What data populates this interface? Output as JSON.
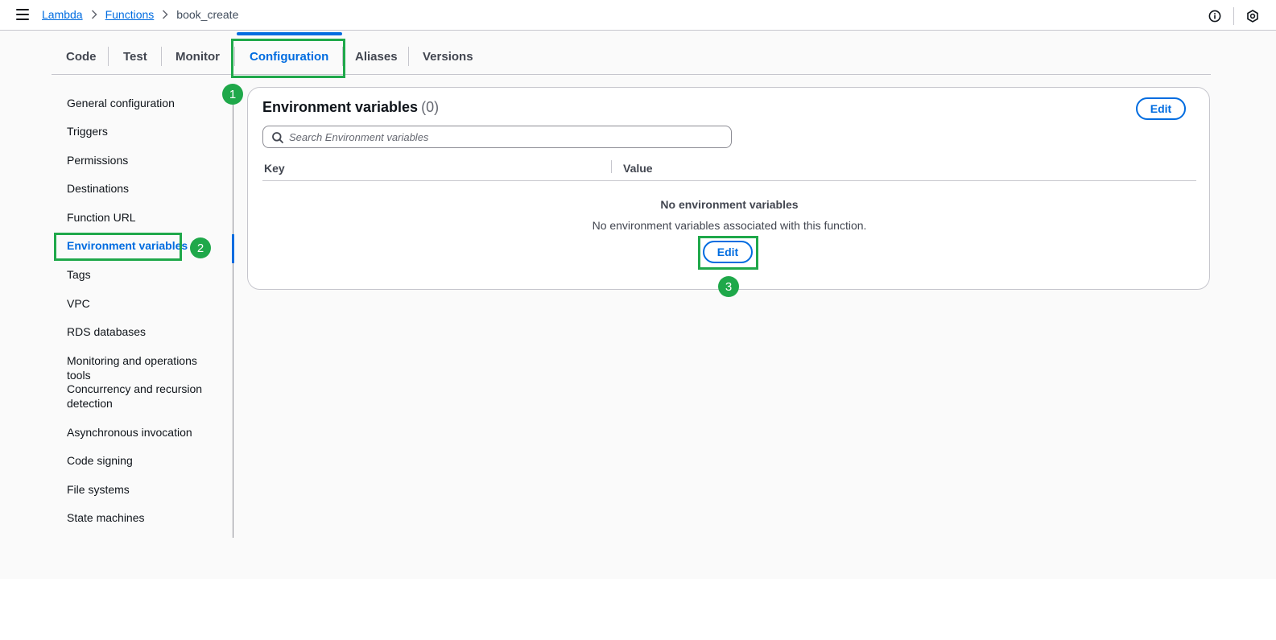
{
  "breadcrumb": {
    "items": [
      {
        "label": "Lambda"
      },
      {
        "label": "Functions"
      }
    ],
    "current": "book_create"
  },
  "header": {
    "icons": [
      "info-icon",
      "settings-hexagon-icon"
    ]
  },
  "tabs": [
    {
      "label": "Code"
    },
    {
      "label": "Test"
    },
    {
      "label": "Monitor"
    },
    {
      "label": "Configuration",
      "active": true
    },
    {
      "label": "Aliases"
    },
    {
      "label": "Versions"
    }
  ],
  "sidebar": {
    "items": [
      {
        "label": "General configuration"
      },
      {
        "label": "Triggers"
      },
      {
        "label": "Permissions"
      },
      {
        "label": "Destinations"
      },
      {
        "label": "Function URL"
      },
      {
        "label": "Environment variables",
        "active": true
      },
      {
        "label": "Tags"
      },
      {
        "label": "VPC"
      },
      {
        "label": "RDS databases"
      },
      {
        "label": "Monitoring and operations tools"
      },
      {
        "label": "Concurrency and recursion detection"
      },
      {
        "label": "Asynchronous invocation"
      },
      {
        "label": "Code signing"
      },
      {
        "label": "File systems"
      },
      {
        "label": "State machines"
      }
    ]
  },
  "panel": {
    "title": "Environment variables",
    "count": "(0)",
    "edit_label": "Edit",
    "search": {
      "placeholder": "Search Environment variables",
      "value": ""
    },
    "columns": [
      "Key",
      "Value"
    ],
    "empty_title": "No environment variables",
    "empty_description": "No environment variables associated with this function.",
    "empty_edit_label": "Edit"
  },
  "annotations": [
    "1",
    "2",
    "3"
  ],
  "colors": {
    "accent": "#006ce0",
    "highlight": "#1fa84a",
    "border": "#c6c6cd",
    "background": "#fafafa"
  }
}
